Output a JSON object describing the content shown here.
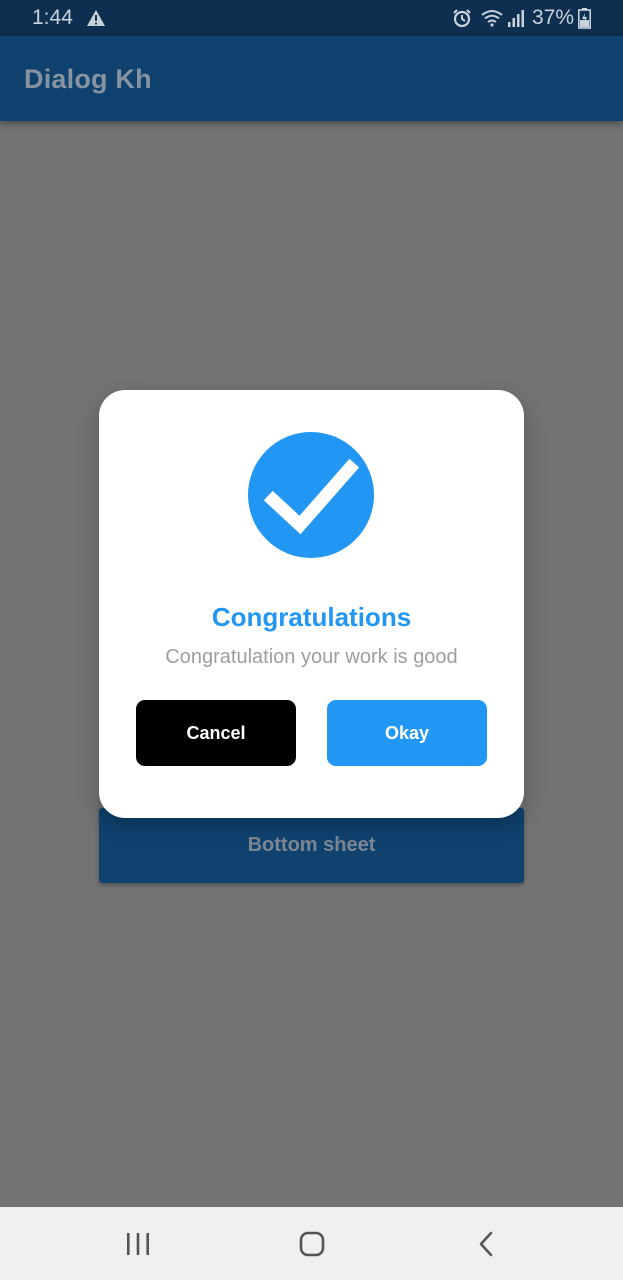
{
  "status_bar": {
    "time": "1:44",
    "battery": "37%",
    "icons": [
      "warning-icon",
      "alarm-icon",
      "wifi-icon",
      "signal-icon",
      "battery-icon"
    ]
  },
  "app_bar": {
    "title": "Dialog Kh"
  },
  "main": {
    "bottom_sheet_label": "Bottom sheet"
  },
  "dialog": {
    "icon": "check-circle-icon",
    "title": "Congratulations",
    "message": "Congratulation your work is good",
    "cancel_label": "Cancel",
    "okay_label": "Okay"
  },
  "nav_bar": {
    "icons": [
      "recent-apps-icon",
      "home-icon",
      "back-icon"
    ]
  },
  "colors": {
    "accent": "#2196f3",
    "app_bar": "#0f426f",
    "status_bar": "#0e2f4f",
    "scrim": "#737373",
    "cancel_button": "#000000"
  }
}
